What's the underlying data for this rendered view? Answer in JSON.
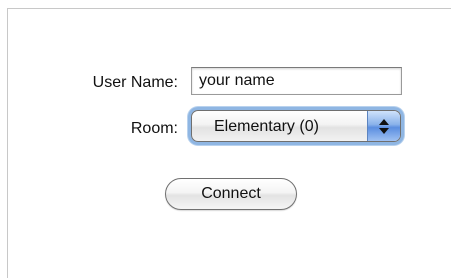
{
  "form": {
    "username_label": "User Name:",
    "username_value": "your name",
    "room_label": "Room:",
    "room_selected": "Elementary (0)",
    "connect_label": "Connect"
  },
  "icons": {
    "stepper": "up-down-chevron-icon"
  },
  "colors": {
    "focus_ring": "#8fb6e3",
    "stepper_blue": "#5b8ee0"
  }
}
